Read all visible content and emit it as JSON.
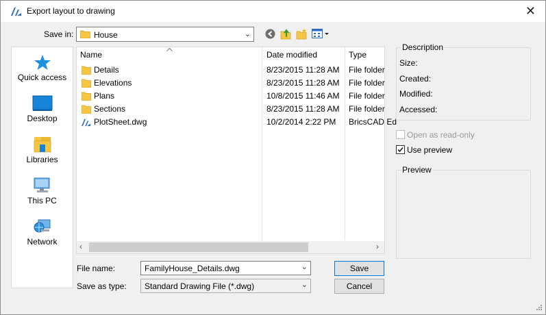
{
  "dialog": {
    "title": "Export layout to drawing",
    "close_label": "✕"
  },
  "save_in": {
    "label": "Save in:",
    "value": "House"
  },
  "places": [
    {
      "label": "Quick access",
      "icon": "star-icon"
    },
    {
      "label": "Desktop",
      "icon": "desktop-icon"
    },
    {
      "label": "Libraries",
      "icon": "libraries-icon"
    },
    {
      "label": "This PC",
      "icon": "computer-icon"
    },
    {
      "label": "Network",
      "icon": "network-icon"
    }
  ],
  "file_list": {
    "columns": [
      "Name",
      "Date modified",
      "Type"
    ],
    "rows": [
      {
        "name": "Details",
        "date": "8/23/2015 11:28 AM",
        "type": "File folder",
        "icon": "folder-icon"
      },
      {
        "name": "Elevations",
        "date": "8/23/2015 11:28 AM",
        "type": "File folder",
        "icon": "folder-icon"
      },
      {
        "name": "Plans",
        "date": "10/8/2015 11:46 AM",
        "type": "File folder",
        "icon": "folder-icon"
      },
      {
        "name": "Sections",
        "date": "8/23/2015 11:28 AM",
        "type": "File folder",
        "icon": "folder-icon"
      },
      {
        "name": "PlotSheet.dwg",
        "date": "10/2/2014 2:22 PM",
        "type": "BricsCAD Ed",
        "icon": "dwg-file-icon"
      }
    ]
  },
  "file_name": {
    "label": "File name:",
    "value": "FamilyHouse_Details.dwg"
  },
  "save_as_type": {
    "label": "Save as type:",
    "value": "Standard Drawing File (*.dwg)"
  },
  "buttons": {
    "save": "Save",
    "cancel": "Cancel"
  },
  "description": {
    "title": "Description",
    "fields": [
      "Size:",
      "Created:",
      "Modified:",
      "Accessed:"
    ]
  },
  "options": {
    "read_only": {
      "label": "Open as read-only",
      "checked": false,
      "enabled": false
    },
    "use_preview": {
      "label": "Use preview",
      "checked": true,
      "enabled": true
    }
  },
  "preview": {
    "title": "Preview"
  },
  "colors": {
    "accent": "#0078d7",
    "folder": "#f5c644",
    "brics": "#2b6cc4"
  }
}
